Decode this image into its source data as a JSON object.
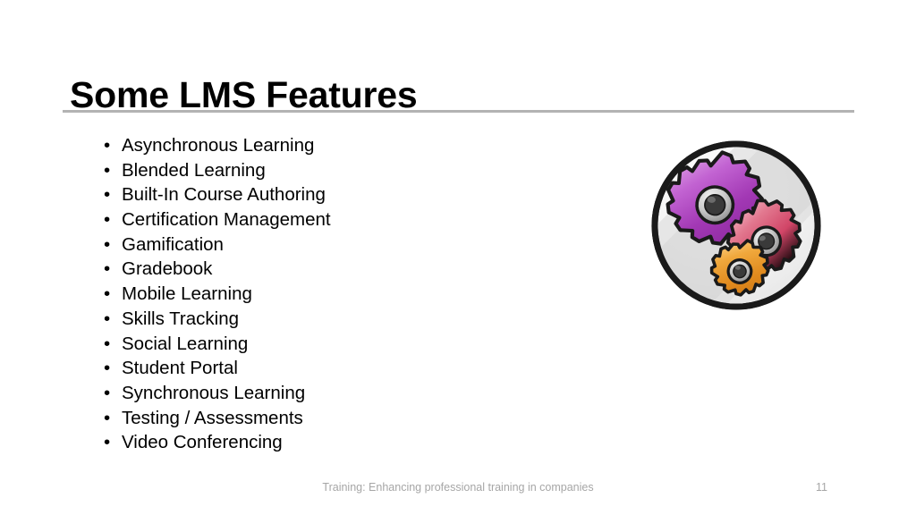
{
  "slide": {
    "title": "Some LMS Features",
    "bullet_glyph": "•",
    "features": [
      "Asynchronous Learning",
      "Blended Learning",
      "Built-In Course Authoring",
      "Certification Management",
      "Gamification",
      "Gradebook",
      "Mobile Learning",
      "Skills Tracking",
      "Social Learning",
      "Student Portal",
      "Synchronous Learning",
      "Testing / Assessments",
      "Video Conferencing"
    ],
    "graphic": {
      "name": "three-gears-icon",
      "description": "Three interlocking gears inside a circle",
      "gears": [
        {
          "label": "large-gear",
          "color": "#a33fb5",
          "highlight": "#d98fe0"
        },
        {
          "label": "medium-gear",
          "color": "#d8456b",
          "highlight": "#f0a0b6"
        },
        {
          "label": "small-gear",
          "color": "#e8962b",
          "highlight": "#f7c878"
        }
      ],
      "outline_color": "#1a1a1a",
      "disc_color": "#f2f2f2"
    },
    "footer": "Training: Enhancing professional training in companies",
    "page_number": "11",
    "colors": {
      "background": "#ffffff",
      "title_text": "#000000",
      "body_text": "#000000",
      "rule": "#b3b3b3",
      "footer_text": "#a6a6a6"
    }
  }
}
